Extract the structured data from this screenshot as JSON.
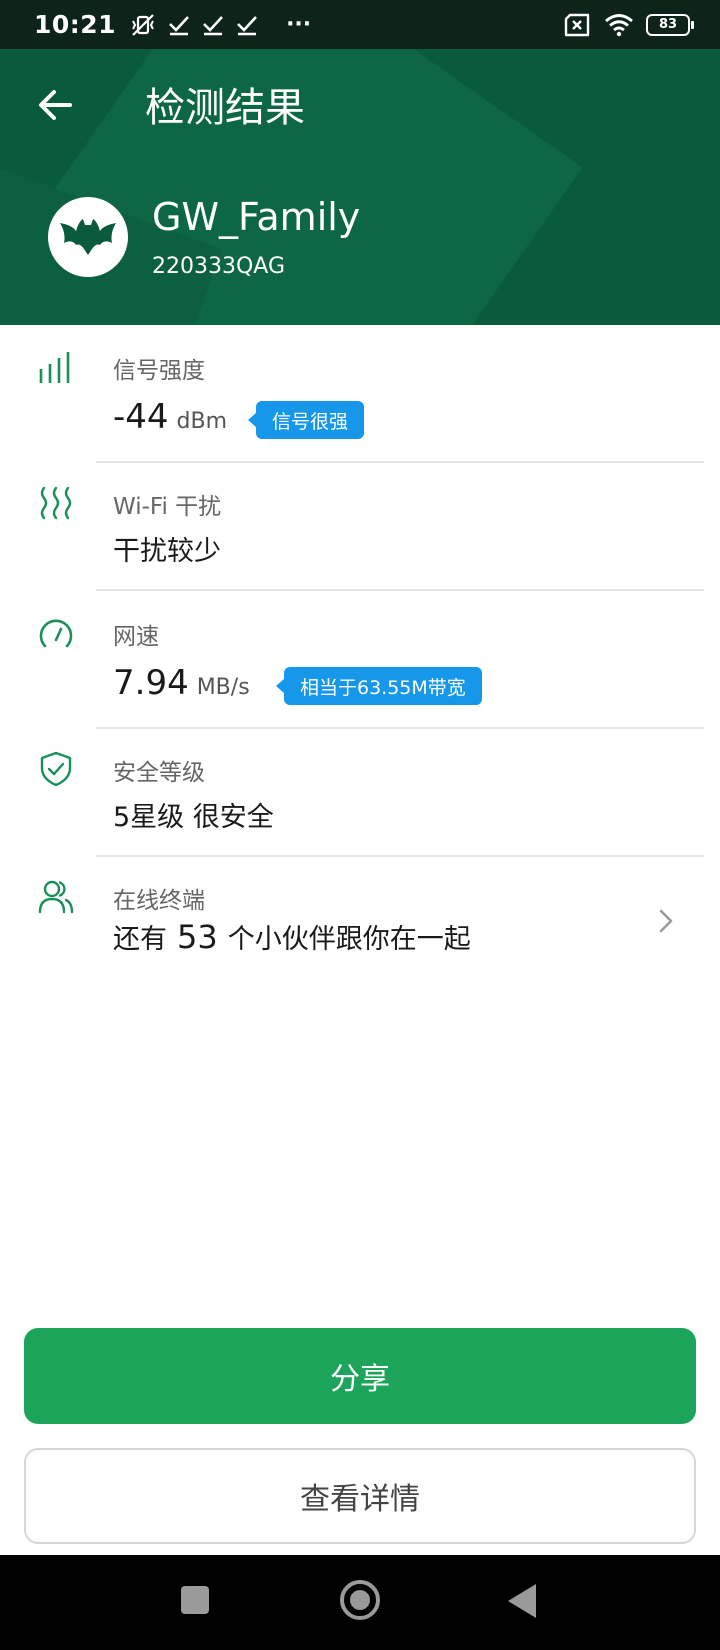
{
  "status_bar": {
    "time": "10:21",
    "more": "···",
    "battery": "83",
    "icons": [
      "vibrate-off-icon",
      "check-icon",
      "check-icon",
      "check-icon",
      "sim-x-icon",
      "wifi-icon",
      "battery-icon"
    ]
  },
  "header": {
    "title": "检测结果",
    "network_name": "GW_Family",
    "network_id": "220333QAG",
    "colors": {
      "header_bg": "#0a5a3c",
      "accent": "#1ca45a",
      "badge": "#1697ea"
    }
  },
  "items": {
    "signal": {
      "label": "信号强度",
      "value": "-44",
      "unit": "dBm",
      "badge": "信号很强"
    },
    "interference": {
      "label": "Wi-Fi 干扰",
      "value": "干扰较少"
    },
    "speed": {
      "label": "网速",
      "value": "7.94",
      "unit": "MB/s",
      "badge": "相当于63.55M带宽"
    },
    "security": {
      "label": "安全等级",
      "value": "5星级 很安全"
    },
    "devices": {
      "label": "在线终端",
      "prefix": "还有",
      "count": "53",
      "suffix": "个小伙伴跟你在一起"
    }
  },
  "buttons": {
    "share": "分享",
    "details": "查看详情"
  }
}
